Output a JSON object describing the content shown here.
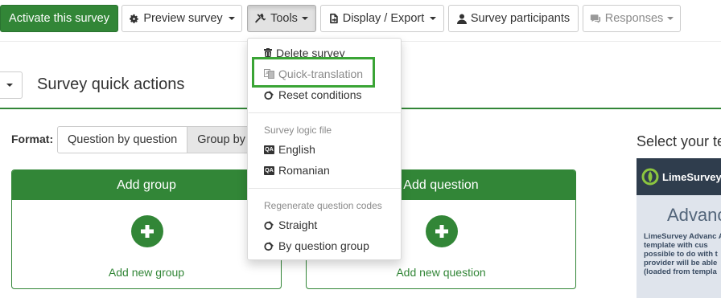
{
  "toolbar": {
    "activate_label": "Activate this survey",
    "preview_label": "Preview survey",
    "tools_label": "Tools",
    "display_export_label": "Display / Export",
    "participants_label": "Survey participants",
    "responses_label": "Responses"
  },
  "tools_menu": {
    "items_top": [
      {
        "label": "Delete survey",
        "icon": "trash-icon"
      },
      {
        "label": "Quick-translation",
        "icon": "translate-icon"
      },
      {
        "label": "Reset conditions",
        "icon": "reset-icon"
      }
    ],
    "logic_header": "Survey logic file",
    "logic_items": [
      {
        "label": "English",
        "icon": "qa-icon"
      },
      {
        "label": "Romanian",
        "icon": "qa-icon"
      }
    ],
    "regen_header": "Regenerate question codes",
    "regen_items": [
      {
        "label": "Straight",
        "icon": "regenerate-icon"
      },
      {
        "label": "By question group",
        "icon": "regenerate-icon"
      }
    ],
    "highlighted_item": "Quick-translation"
  },
  "quick_actions": {
    "title": "Survey quick actions",
    "format_label": "Format:",
    "format_options": [
      "Question by question",
      "Group by g"
    ],
    "selected_format": "Group by g"
  },
  "panels": {
    "add_group": {
      "title": "Add group",
      "link": "Add new group"
    },
    "add_question": {
      "title": "Add question",
      "link": "Add new question"
    }
  },
  "template": {
    "title": "Select your te",
    "logo_text": "LimeSurvey",
    "heading": "Advanc",
    "description": "LimeSurvey Advanc A template with cus possible to do with t provider will be able (loaded from templa"
  },
  "colors": {
    "primary": "#328637",
    "highlight": "#3aa435"
  }
}
